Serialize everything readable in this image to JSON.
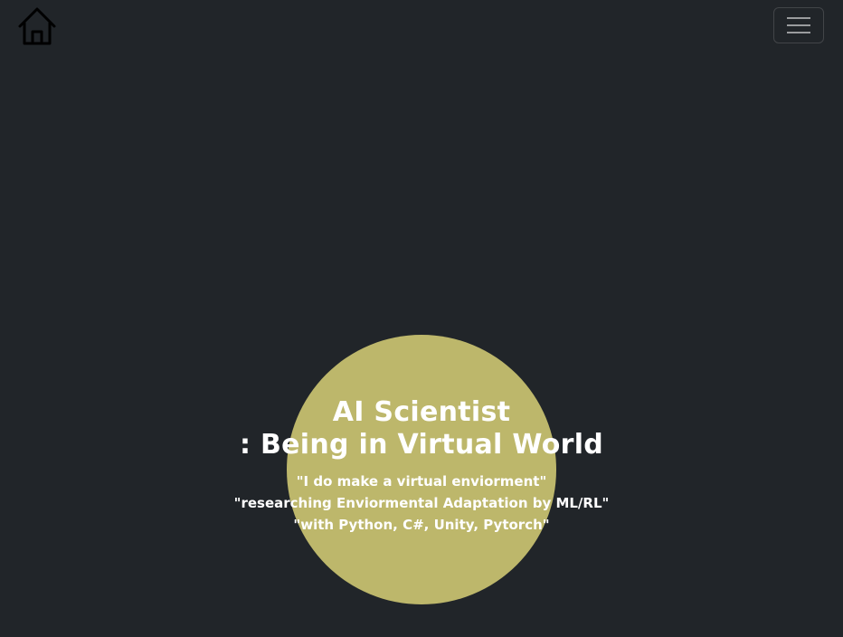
{
  "navbar": {
    "home_icon": "home-icon",
    "menu_icon": "hamburger-menu-icon"
  },
  "hero": {
    "title_line1": "AI Scientist",
    "title_line2": ": Being in Virtual World",
    "lines": [
      "\"I do make a virtual enviorment\"",
      "\"researching Enviormental Adaptation by ML/RL\"",
      "\"with Python, C#, Unity, Pytorch\""
    ]
  },
  "colors": {
    "background": "#212529",
    "circle": "#bdb76b",
    "text": "#ffffff"
  }
}
